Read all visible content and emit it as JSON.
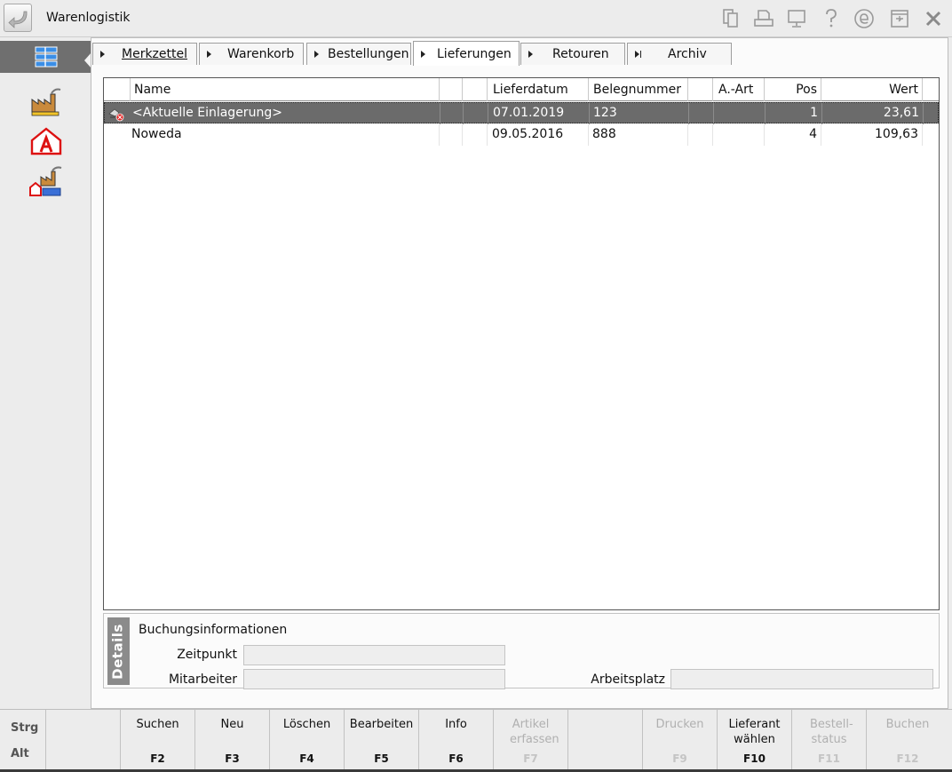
{
  "window": {
    "title": "Warenlogistik"
  },
  "tabs": [
    {
      "label": "Merkzettel",
      "active": false
    },
    {
      "label": "Warenkorb",
      "active": false
    },
    {
      "label": "Bestellungen",
      "active": false
    },
    {
      "label": "Lieferungen",
      "active": true
    },
    {
      "label": "Retouren",
      "active": false
    },
    {
      "label": "Archiv",
      "active": false
    }
  ],
  "table": {
    "columns": [
      "Name",
      "Lieferdatum",
      "Belegnummer",
      "A.-Art",
      "Pos",
      "Wert"
    ],
    "rows": [
      {
        "name": "<Aktuelle Einlagerung>",
        "lieferdatum": "07.01.2019",
        "belegnummer": "123",
        "art": "",
        "pos": "1",
        "wert": "23,61",
        "selected": true
      },
      {
        "name": "Noweda",
        "lieferdatum": "09.05.2016",
        "belegnummer": "888",
        "art": "",
        "pos": "4",
        "wert": "109,63",
        "selected": false
      }
    ]
  },
  "details": {
    "tab_label": "Details",
    "heading": "Buchungsinformationen",
    "zeitpunkt_label": "Zeitpunkt",
    "zeitpunkt_value": "",
    "mitarbeiter_label": "Mitarbeiter",
    "mitarbeiter_value": "",
    "arbeitsplatz_label": "Arbeitsplatz",
    "arbeitsplatz_value": ""
  },
  "modifiers": {
    "strg": "Strg",
    "alt": "Alt"
  },
  "fkeys": [
    {
      "label": "Suchen",
      "key": "F2",
      "enabled": true
    },
    {
      "label": "Neu",
      "key": "F3",
      "enabled": true
    },
    {
      "label": "Löschen",
      "key": "F4",
      "enabled": true
    },
    {
      "label": "Bearbeiten",
      "key": "F5",
      "enabled": true
    },
    {
      "label": "Info",
      "key": "F6",
      "enabled": true
    },
    {
      "label": "Artikel erfassen",
      "key": "F7",
      "enabled": false
    },
    {
      "label": "",
      "key": "",
      "enabled": false
    },
    {
      "label": "Drucken",
      "key": "F9",
      "enabled": false
    },
    {
      "label": "Lieferant wählen",
      "key": "F10",
      "enabled": true
    },
    {
      "label": "Bestell-status",
      "key": "F11",
      "enabled": false
    },
    {
      "label": "Buchen",
      "key": "F12",
      "enabled": false
    }
  ],
  "colors": {
    "selected_row": "#6b6b6b",
    "nav_active": "#6f6f6f",
    "details_tab": "#8b8b8b"
  }
}
